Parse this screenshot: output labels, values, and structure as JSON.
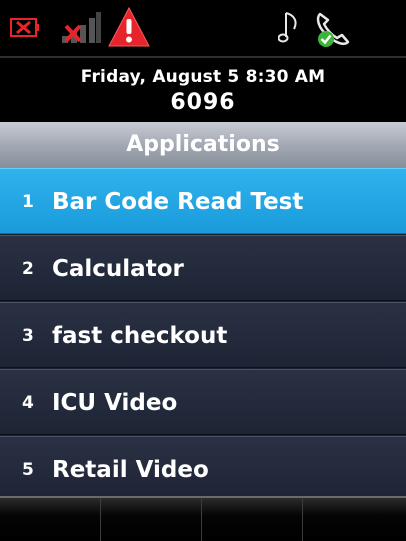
{
  "status_bar": {
    "icons": [
      "battery-empty-icon",
      "no-signal-icon",
      "alert-icon",
      "ringer-icon",
      "call-handset-icon"
    ],
    "colors": {
      "battery": "#e6242b",
      "alert": "#e6242b",
      "signal_x": "#e6242b",
      "call_check": "#3cb43c"
    }
  },
  "header": {
    "date_time": "Friday, August 5 8:30 AM",
    "extension": "6096"
  },
  "title": "Applications",
  "applications": [
    {
      "number": "1",
      "label": "Bar Code Read Test",
      "selected": true
    },
    {
      "number": "2",
      "label": "Calculator"
    },
    {
      "number": "3",
      "label": "fast checkout"
    },
    {
      "number": "4",
      "label": "ICU Video"
    },
    {
      "number": "5",
      "label": "Retail Video"
    }
  ],
  "softkeys": [
    "",
    "",
    "",
    ""
  ],
  "colors": {
    "selected": "#1fa6e4",
    "list_bg": "#222a3c",
    "title_bar": "#a3a9b3"
  }
}
